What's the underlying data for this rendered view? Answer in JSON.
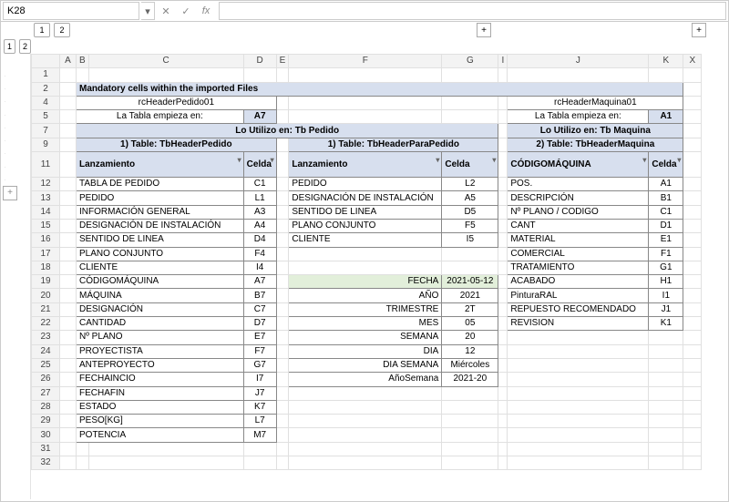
{
  "namebox": "K28",
  "title": "Mandatory cells within the imported Files",
  "left": {
    "name": "rcHeaderPedido01",
    "startsInLabel": "La Tabla empieza en:",
    "startsIn": "A7",
    "usedIn": "Lo Utilizo en: Tb Pedido",
    "table1": "1) Table: TbHeaderPedido",
    "col1": "Lanzamiento",
    "col2": "Celda",
    "rows": [
      [
        "TABLA DE PEDIDO",
        "C1"
      ],
      [
        "PEDIDO",
        "L1"
      ],
      [
        "INFORMACIÓN GENERAL",
        "A3"
      ],
      [
        "DESIGNACIÓN DE INSTALACIÓN",
        "A4"
      ],
      [
        "SENTIDO DE LINEA",
        "D4"
      ],
      [
        "PLANO CONJUNTO",
        "F4"
      ],
      [
        "CLIENTE",
        "I4"
      ],
      [
        "CÓDIGOMÁQUINA",
        "A7"
      ],
      [
        "MÁQUINA",
        "B7"
      ],
      [
        "DESIGNACIÓN",
        "C7"
      ],
      [
        "CANTIDAD",
        "D7"
      ],
      [
        "Nº PLANO",
        "E7"
      ],
      [
        "PROYECTISTA",
        "F7"
      ],
      [
        "ANTEPROYECTO",
        "G7"
      ],
      [
        "FECHAINCIO",
        "I7"
      ],
      [
        "FECHAFIN",
        "J7"
      ],
      [
        "ESTADO",
        "K7"
      ],
      [
        "PESO[KG]",
        "L7"
      ],
      [
        "POTENCIA",
        "M7"
      ]
    ]
  },
  "mid": {
    "table1": "1) Table: TbHeaderParaPedido",
    "col1": "Lanzamiento",
    "col2": "Celda",
    "rows": [
      [
        "PEDIDO",
        "L2"
      ],
      [
        "DESIGNACIÓN DE INSTALACIÓN",
        "A5"
      ],
      [
        "SENTIDO DE LINEA",
        "D5"
      ],
      [
        "PLANO CONJUNTO",
        "F5"
      ],
      [
        "CLIENTE",
        "I5"
      ]
    ],
    "dates": [
      [
        "FECHA",
        "2021-05-12"
      ],
      [
        "AÑO",
        "2021"
      ],
      [
        "TRIMESTRE",
        "2T"
      ],
      [
        "MES",
        "05"
      ],
      [
        "SEMANA",
        "20"
      ],
      [
        "DIA",
        "12"
      ],
      [
        "DIA SEMANA",
        "Miércoles"
      ],
      [
        "AñoSemana",
        "2021-20"
      ]
    ]
  },
  "right": {
    "name": "rcHeaderMaquina01",
    "startsInLabel": "La Tabla empieza en:",
    "startsIn": "A1",
    "usedIn": "Lo Utilizo en: Tb Maquina",
    "table1": "2) Table: TbHeaderMaquina",
    "col1": "CÓDIGOMÁQUINA",
    "col2": "Celda",
    "rows": [
      [
        "POS.",
        "A1"
      ],
      [
        "DESCRIPCIÓN",
        "B1"
      ],
      [
        "Nº PLANO / CODIGO",
        "C1"
      ],
      [
        "CANT",
        "D1"
      ],
      [
        "MATERIAL",
        "E1"
      ],
      [
        "COMERCIAL",
        "F1"
      ],
      [
        "TRATAMIENTO",
        "G1"
      ],
      [
        "ACABADO",
        "H1"
      ],
      [
        "PinturaRAL",
        "I1"
      ],
      [
        "REPUESTO RECOMENDADO",
        "J1"
      ],
      [
        "REVISION",
        "K1"
      ]
    ]
  },
  "cols": [
    "A",
    "B",
    "C",
    "D",
    "E",
    "F",
    "G",
    "I",
    "J",
    "K",
    "X"
  ],
  "rowsStart": 1,
  "rowsEnd": 32,
  "outline": {
    "colLevels": [
      "1",
      "2"
    ],
    "rowLevels": [
      "1",
      "2"
    ]
  },
  "chart_data": null
}
